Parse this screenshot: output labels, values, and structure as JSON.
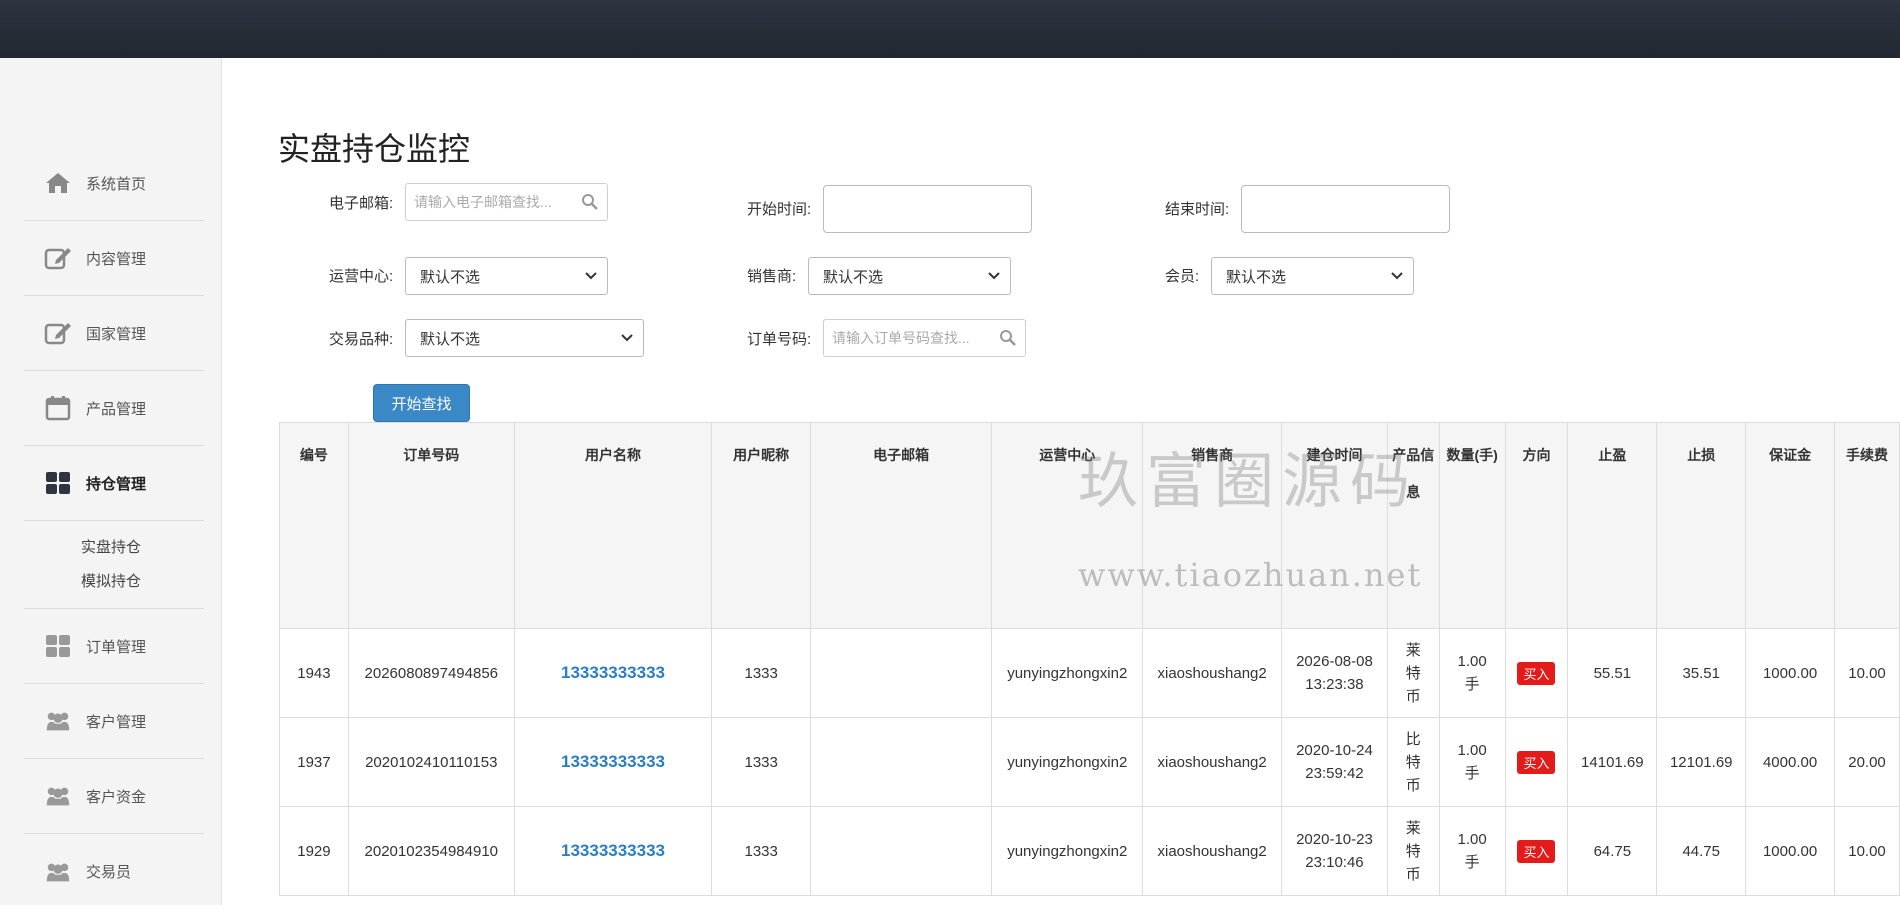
{
  "sidebar": {
    "items": [
      {
        "label": "系统首页",
        "icon": "home-icon"
      },
      {
        "label": "内容管理",
        "icon": "edit-icon"
      },
      {
        "label": "国家管理",
        "icon": "edit-icon"
      },
      {
        "label": "产品管理",
        "icon": "calendar-icon"
      },
      {
        "label": "持仓管理",
        "icon": "grid-icon"
      },
      {
        "label": "订单管理",
        "icon": "grid-icon"
      },
      {
        "label": "客户管理",
        "icon": "users-icon"
      },
      {
        "label": "客户资金",
        "icon": "users-icon"
      },
      {
        "label": "交易员",
        "icon": "users-icon"
      }
    ],
    "sub_items": [
      "实盘持仓",
      "模拟持仓"
    ]
  },
  "page": {
    "title": "实盘持仓监控"
  },
  "filters": {
    "email_label": "电子邮箱:",
    "email_placeholder": "请输入电子邮箱查找...",
    "start_label": "开始时间:",
    "end_label": "结束时间:",
    "center_label": "运营中心:",
    "center_value": "默认不选",
    "dealer_label": "销售商:",
    "dealer_value": "默认不选",
    "member_label": "会员:",
    "member_value": "默认不选",
    "product_label": "交易品种:",
    "product_value": "默认不选",
    "order_label": "订单号码:",
    "order_placeholder": "请输入订单号码查找...",
    "search_button": "开始查找"
  },
  "table": {
    "headers": [
      "编号",
      "订单号码",
      "用户名称",
      "用户昵称",
      "电子邮箱",
      "运营中心",
      "销售商",
      "建仓时间",
      "产品信息",
      "数量(手)",
      "方向",
      "止盈",
      "止损",
      "保证金",
      "手续费"
    ],
    "rows": [
      {
        "id": "1943",
        "order": "2026080897494856",
        "user": "13333333333",
        "nick": "1333",
        "email": "",
        "center": "yunyingzhongxin2",
        "dealer": "xiaoshoushang2",
        "date": "2026-08-08",
        "time": "13:23:38",
        "product": [
          "莱",
          "特",
          "币"
        ],
        "qty": "1.00",
        "unit": "手",
        "dir": "买入",
        "tp": "55.51",
        "sl": "35.51",
        "margin": "1000.00",
        "fee": "10.00"
      },
      {
        "id": "1937",
        "order": "2020102410110153",
        "user": "13333333333",
        "nick": "1333",
        "email": "",
        "center": "yunyingzhongxin2",
        "dealer": "xiaoshoushang2",
        "date": "2020-10-24",
        "time": "23:59:42",
        "product": [
          "比",
          "特",
          "币"
        ],
        "qty": "1.00",
        "unit": "手",
        "dir": "买入",
        "tp": "14101.69",
        "sl": "12101.69",
        "margin": "4000.00",
        "fee": "20.00"
      },
      {
        "id": "1929",
        "order": "2020102354984910",
        "user": "13333333333",
        "nick": "1333",
        "email": "",
        "center": "yunyingzhongxin2",
        "dealer": "xiaoshoushang2",
        "date": "2020-10-23",
        "time": "23:10:46",
        "product": [
          "莱",
          "特",
          "币"
        ],
        "qty": "1.00",
        "unit": "手",
        "dir": "买入",
        "tp": "64.75",
        "sl": "44.75",
        "margin": "1000.00",
        "fee": "10.00"
      }
    ]
  },
  "watermark": {
    "cn": "玖富圈源码",
    "url": "www.tiaozhuan.net"
  },
  "colors": {
    "topbar": "#262c36",
    "accent": "#3a88c6",
    "link": "#2a7ec4",
    "buy": "#e31b1b"
  }
}
